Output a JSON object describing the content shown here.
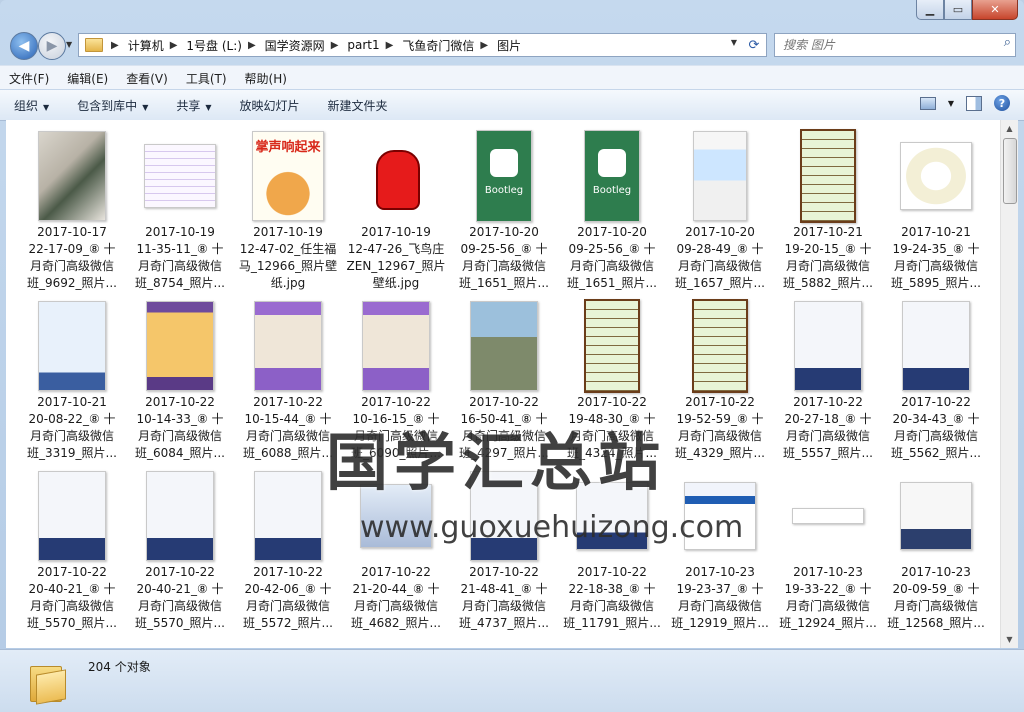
{
  "window": {
    "minimize_icon": "minimize-icon",
    "maximize_icon": "maximize-icon",
    "close_icon": "close-icon"
  },
  "address": {
    "crumbs": [
      "计算机",
      "1号盘 (L:)",
      "国学资源网",
      "part1",
      "飞鱼奇门微信",
      "图片"
    ],
    "search_placeholder": "搜索 图片"
  },
  "menu": [
    "文件(F)",
    "编辑(E)",
    "查看(V)",
    "工具(T)",
    "帮助(H)"
  ],
  "commands": {
    "organize": "组织",
    "include": "包含到库中",
    "share": "共享",
    "slideshow": "放映幻灯片",
    "new_folder": "新建文件夹"
  },
  "files": [
    {
      "l1": "2017-10-17",
      "l2": "22-17-09_⑧ 十",
      "l3": "月奇门高级微信",
      "l4": "班_9692_照片...",
      "thumb": "photo-desk"
    },
    {
      "l1": "2017-10-19",
      "l2": "11-35-11_⑧ 十",
      "l3": "月奇门高级微信",
      "l4": "班_8754_照片...",
      "thumb": "doc-chart"
    },
    {
      "l1": "2017-10-19",
      "l2": "12-47-02_任生福",
      "l3": "马_12966_照片壁",
      "l4": "纸.jpg",
      "thumb": "clap"
    },
    {
      "l1": "2017-10-19",
      "l2": "12-47-26_飞鸟庄",
      "l3": "ZEN_12967_照片",
      "l4": "壁纸.jpg",
      "thumb": "thumbup"
    },
    {
      "l1": "2017-10-20",
      "l2": "09-25-56_⑧ 十",
      "l3": "月奇门高级微信",
      "l4": "班_1651_照片...",
      "thumb": "bootleg"
    },
    {
      "l1": "2017-10-20",
      "l2": "09-25-56_⑧ 十",
      "l3": "月奇门高级微信",
      "l4": "班_1651_照片...",
      "thumb": "bootleg"
    },
    {
      "l1": "2017-10-20",
      "l2": "09-28-49_⑧ 十",
      "l3": "月奇门高级微信",
      "l4": "班_1657_照片...",
      "thumb": "phone-ui"
    },
    {
      "l1": "2017-10-21",
      "l2": "19-20-15_⑧ 十",
      "l3": "月奇门高级微信",
      "l4": "班_5882_照片...",
      "thumb": "green-table"
    },
    {
      "l1": "2017-10-21",
      "l2": "19-24-35_⑧ 十",
      "l3": "月奇门高级微信",
      "l4": "班_5895_照片...",
      "thumb": "circle-chart"
    },
    {
      "l1": "2017-10-21",
      "l2": "20-08-22_⑧ 十",
      "l3": "月奇门高级微信",
      "l4": "班_3319_照片...",
      "thumb": "blue-diagram"
    },
    {
      "l1": "2017-10-22",
      "l2": "10-14-33_⑧ 十",
      "l3": "月奇门高级微信",
      "l4": "班_6084_照片...",
      "thumb": "app-screen"
    },
    {
      "l1": "2017-10-22",
      "l2": "10-15-44_⑧ 十",
      "l3": "月奇门高级微信",
      "l4": "班_6088_照片...",
      "thumb": "app-screen2"
    },
    {
      "l1": "2017-10-22",
      "l2": "10-16-15_⑧ 十",
      "l3": "月奇门高级微信",
      "l4": "班_6090_照片...",
      "thumb": "app-screen2"
    },
    {
      "l1": "2017-10-22",
      "l2": "16-50-41_⑧ 十",
      "l3": "月奇门高级微信",
      "l4": "班_4297_照片...",
      "thumb": "photo-person"
    },
    {
      "l1": "2017-10-22",
      "l2": "19-48-30_⑧ 十",
      "l3": "月奇门高级微信",
      "l4": "班_4324_照片...",
      "thumb": "green-table"
    },
    {
      "l1": "2017-10-22",
      "l2": "19-52-59_⑧ 十",
      "l3": "月奇门高级微信",
      "l4": "班_4329_照片...",
      "thumb": "green-table"
    },
    {
      "l1": "2017-10-22",
      "l2": "20-27-18_⑧ 十",
      "l3": "月奇门高级微信",
      "l4": "班_5557_照片...",
      "thumb": "whiteboard"
    },
    {
      "l1": "2017-10-22",
      "l2": "20-34-43_⑧ 十",
      "l3": "月奇门高级微信",
      "l4": "班_5562_照片...",
      "thumb": "whiteboard"
    },
    {
      "l1": "2017-10-22",
      "l2": "20-40-21_⑧ 十",
      "l3": "月奇门高级微信",
      "l4": "班_5570_照片...",
      "thumb": "whiteboard"
    },
    {
      "l1": "2017-10-22",
      "l2": "20-40-21_⑧ 十",
      "l3": "月奇门高级微信",
      "l4": "班_5570_照片...",
      "thumb": "whiteboard"
    },
    {
      "l1": "2017-10-22",
      "l2": "20-42-06_⑧ 十",
      "l3": "月奇门高级微信",
      "l4": "班_5572_照片...",
      "thumb": "whiteboard"
    },
    {
      "l1": "2017-10-22",
      "l2": "21-20-44_⑧ 十",
      "l3": "月奇门高级微信",
      "l4": "班_4682_照片...",
      "thumb": "wide-board"
    },
    {
      "l1": "2017-10-22",
      "l2": "21-48-41_⑧ 十",
      "l3": "月奇门高级微信",
      "l4": "班_4737_照片...",
      "thumb": "whiteboard"
    },
    {
      "l1": "2017-10-22",
      "l2": "22-18-38_⑧ 十",
      "l3": "月奇门高级微信",
      "l4": "班_11791_照片...",
      "thumb": "whiteboard-wide"
    },
    {
      "l1": "2017-10-23",
      "l2": "19-23-37_⑧ 十",
      "l3": "月奇门高级微信",
      "l4": "班_12919_照片...",
      "thumb": "red-blue"
    },
    {
      "l1": "2017-10-23",
      "l2": "19-33-22_⑧ 十",
      "l3": "月奇门高级微信",
      "l4": "班_12924_照片...",
      "thumb": "blank-note"
    },
    {
      "l1": "2017-10-23",
      "l2": "20-09-59_⑧ 十",
      "l3": "月奇门高级微信",
      "l4": "班_12568_照片...",
      "thumb": "screen-blue"
    }
  ],
  "watermark": {
    "title": "国学汇总站",
    "url": "www.guoxuehuizong.com"
  },
  "status": {
    "count": "204 个对象"
  }
}
